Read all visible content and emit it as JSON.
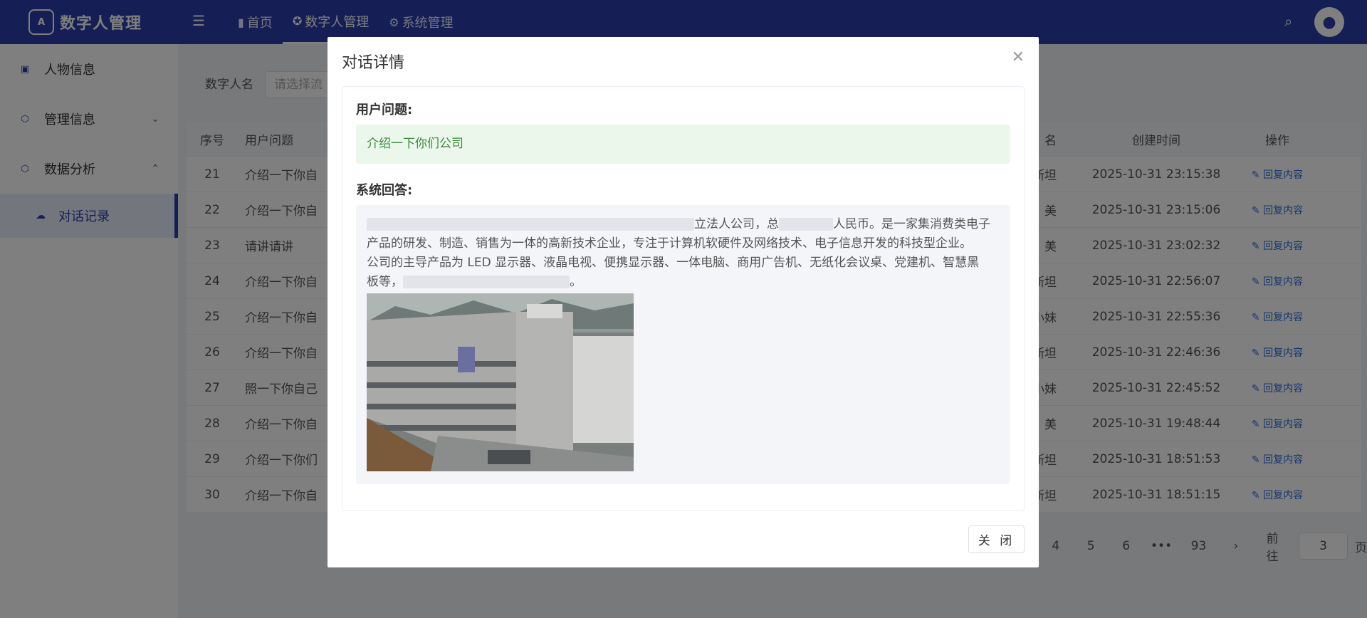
{
  "app": {
    "title": "数字人管理",
    "logo_mark": "A"
  },
  "nav": [
    {
      "icon": "bar-chart-icon",
      "label": "首页"
    },
    {
      "icon": "puzzle-icon",
      "label": "数字人管理"
    },
    {
      "icon": "gear-icon",
      "label": "系统管理"
    }
  ],
  "sidebar": {
    "items": [
      {
        "icon": "person-icon",
        "label": "人物信息"
      },
      {
        "icon": "ai-icon",
        "label": "管理信息"
      },
      {
        "icon": "ai-icon",
        "label": "数据分析"
      }
    ],
    "sub_item": {
      "icon": "cloud-icon",
      "label": "对话记录"
    }
  },
  "filter": {
    "label": "数字人名",
    "placeholder": "请选择流"
  },
  "table": {
    "headers": {
      "idx": "序号",
      "question": "用户问题",
      "name": "名",
      "time": "创建时间",
      "op": "操作"
    },
    "rows": [
      {
        "idx": "21",
        "question": "介绍一下你自",
        "name": "因斯坦",
        "time": "2025-10-31 23:15:38",
        "op": "回复内容"
      },
      {
        "idx": "22",
        "question": "介绍一下你自",
        "name": "美",
        "time": "2025-10-31 23:15:06",
        "op": "回复内容"
      },
      {
        "idx": "23",
        "question": "请讲请讲",
        "name": "美",
        "time": "2025-10-31 23:02:32",
        "op": "回复内容"
      },
      {
        "idx": "24",
        "question": "介绍一下你自",
        "name": "因斯坦",
        "time": "2025-10-31 22:56:07",
        "op": "回复内容"
      },
      {
        "idx": "25",
        "question": "介绍一下你自",
        "name": "小妹",
        "time": "2025-10-31 22:55:36",
        "op": "回复内容"
      },
      {
        "idx": "26",
        "question": "介绍一下你自",
        "name": "因斯坦",
        "time": "2025-10-31 22:46:36",
        "op": "回复内容"
      },
      {
        "idx": "27",
        "question": "照一下你自己",
        "name": "小妹",
        "time": "2025-10-31 22:45:52",
        "op": "回复内容"
      },
      {
        "idx": "28",
        "question": "介绍一下你自",
        "name": "美",
        "time": "2025-10-31 19:48:44",
        "op": "回复内容"
      },
      {
        "idx": "29",
        "question": "介绍一下你们",
        "name": "因斯坦",
        "time": "2025-10-31 18:51:53",
        "op": "回复内容"
      },
      {
        "idx": "30",
        "question": "介绍一下你自",
        "name": "因斯坦",
        "time": "2025-10-31 18:51:15",
        "op": "回复内容"
      }
    ]
  },
  "pagination": {
    "pages": [
      "4",
      "5",
      "6",
      "•••",
      "93"
    ],
    "next": "›",
    "goto_label": "前往",
    "goto_value": "3",
    "goto_suffix": "页"
  },
  "dialog": {
    "title": "对话详情",
    "question_label": "用户问题:",
    "question": "介绍一下你们公司",
    "answer_label": "系统回答:",
    "answer_line1a": "立法人公司，总",
    "answer_line1b": "人民币。是一家集消费类电子",
    "answer_line2": "产品的研发、制造、销售为一体的高新技术企业，专注于计算机软硬件及网络技术、电子信息开发的科技型企业。",
    "answer_line3": "公司的主导产品为 LED 显示器、液晶电视、便携显示器、一体电脑、商用广告机、无纸化会议桌、党建机、智慧黑",
    "answer_line4a": "板等，",
    "answer_line4b": "。",
    "close_button": "关 闭"
  }
}
